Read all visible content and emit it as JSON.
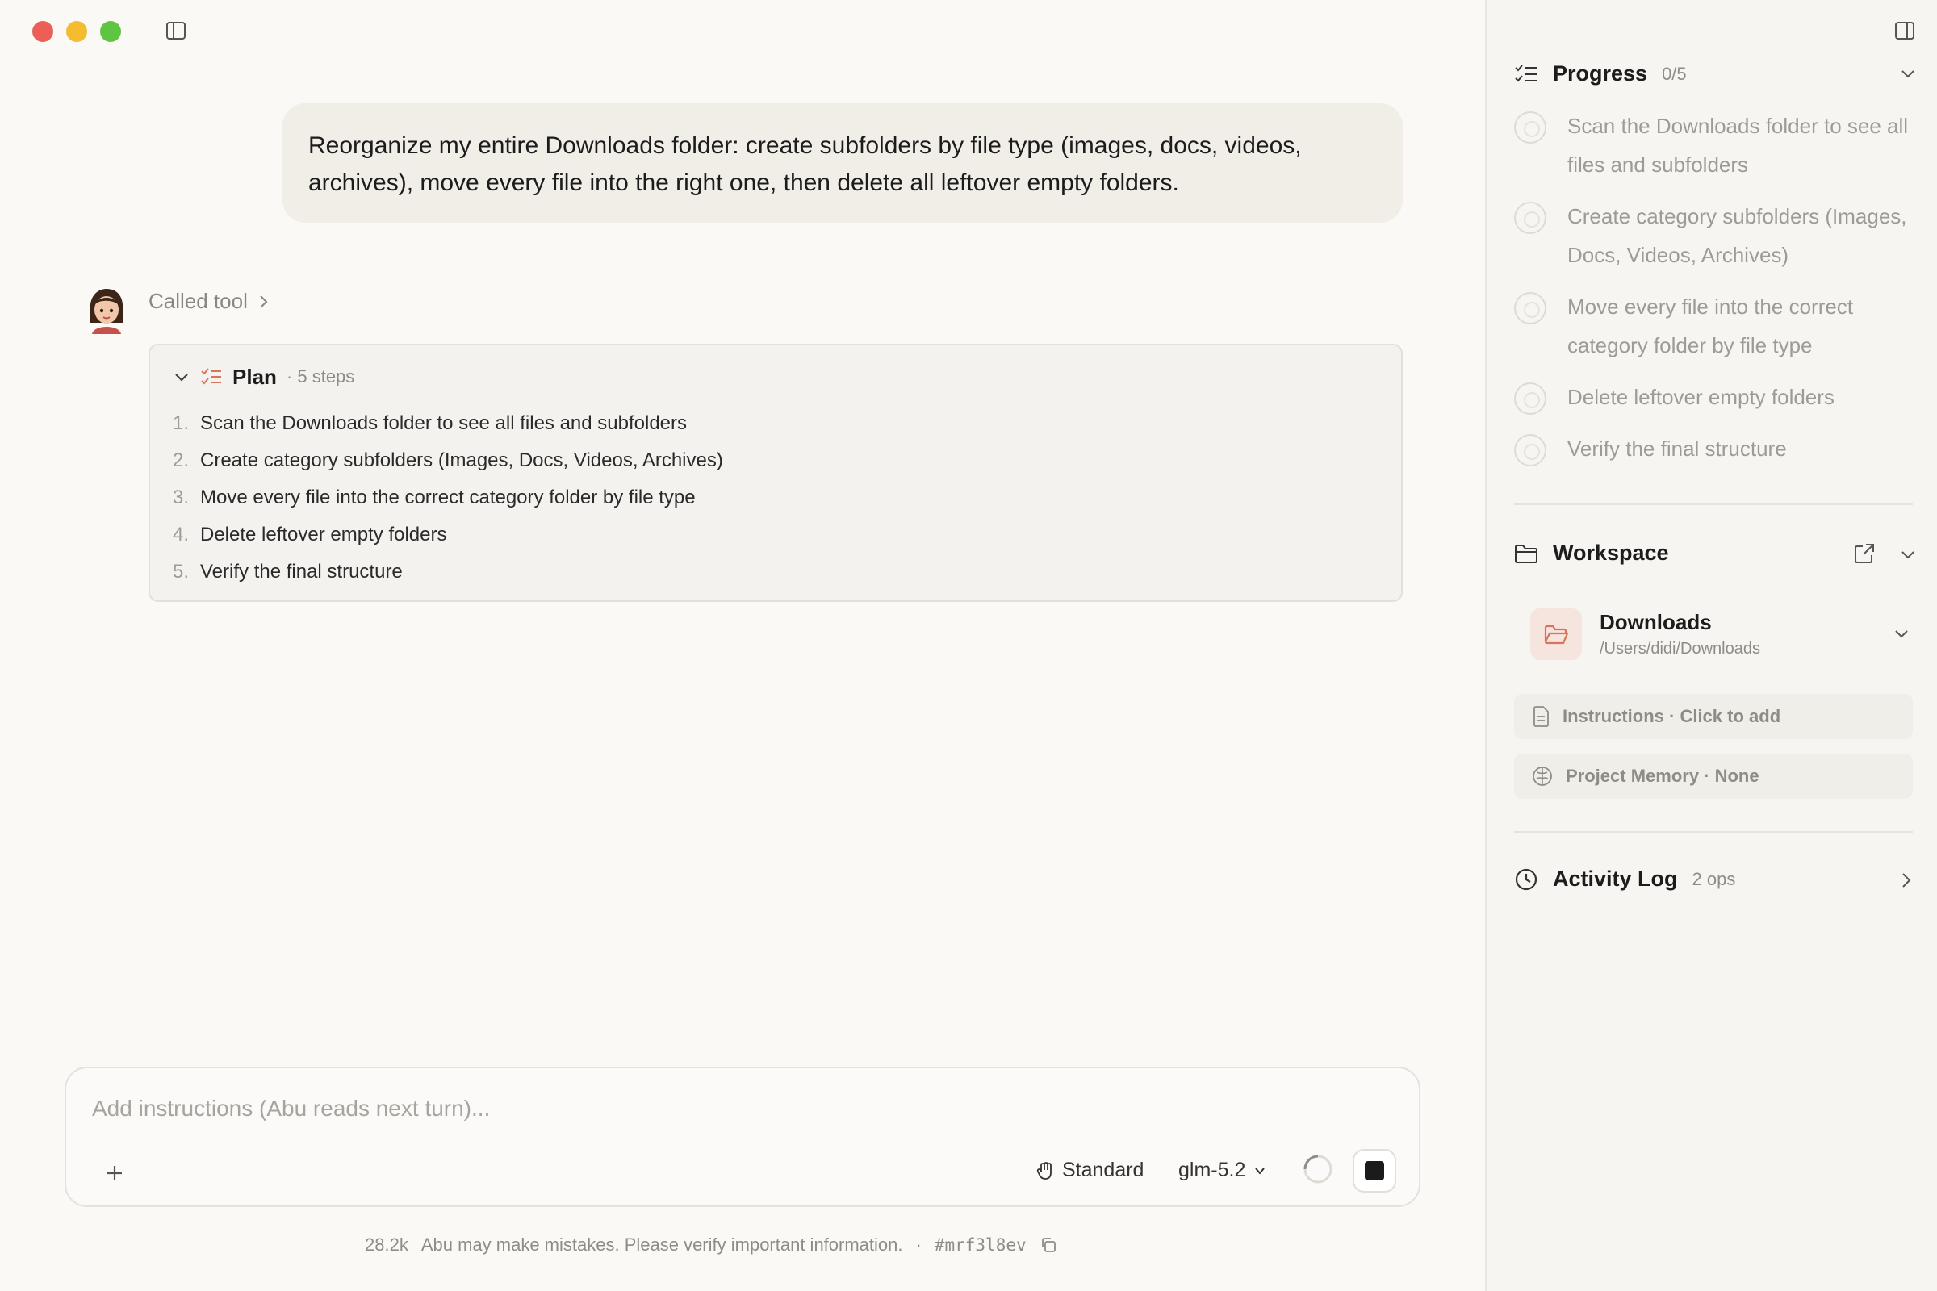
{
  "user_message": "Reorganize my entire Downloads folder: create subfolders by file type (images, docs, videos, archives), move every file into the right one, then delete all leftover empty folders.",
  "tool_call": {
    "label": "Called tool"
  },
  "plan": {
    "title": "Plan",
    "meta": "· 5 steps",
    "steps": [
      {
        "num": "1.",
        "text": "Scan the Downloads folder to see all files and subfolders"
      },
      {
        "num": "2.",
        "text": "Create category subfolders (Images, Docs, Videos, Archives)"
      },
      {
        "num": "3.",
        "text": "Move every file into the correct category folder by file type"
      },
      {
        "num": "4.",
        "text": "Delete leftover empty folders"
      },
      {
        "num": "5.",
        "text": "Verify the final structure"
      }
    ]
  },
  "composer": {
    "placeholder": "Add instructions (Abu reads next turn)...",
    "mode": "Standard",
    "model": "glm-5.2"
  },
  "footer": {
    "tokens": "28.2k",
    "disclaimer": "Abu may make mistakes. Please verify important information.",
    "separator": "·",
    "session_id": "#mrf3l8ev"
  },
  "progress": {
    "title": "Progress",
    "count": "0/5",
    "items": [
      "Scan the Downloads folder to see all files and subfolders",
      "Create category subfolders (Images, Docs, Videos, Archives)",
      "Move every file into the correct category folder by file type",
      "Delete leftover empty folders",
      "Verify the final structure"
    ]
  },
  "workspace": {
    "title": "Workspace",
    "folder_name": "Downloads",
    "folder_path": "/Users/didi/Downloads",
    "instructions": "Instructions · Click to add",
    "memory": "Project Memory · None"
  },
  "activity": {
    "title": "Activity Log",
    "count": "2 ops"
  },
  "colors": {
    "accent": "#d9735a",
    "background": "#faf9f6",
    "panel": "#f7f5f1"
  }
}
